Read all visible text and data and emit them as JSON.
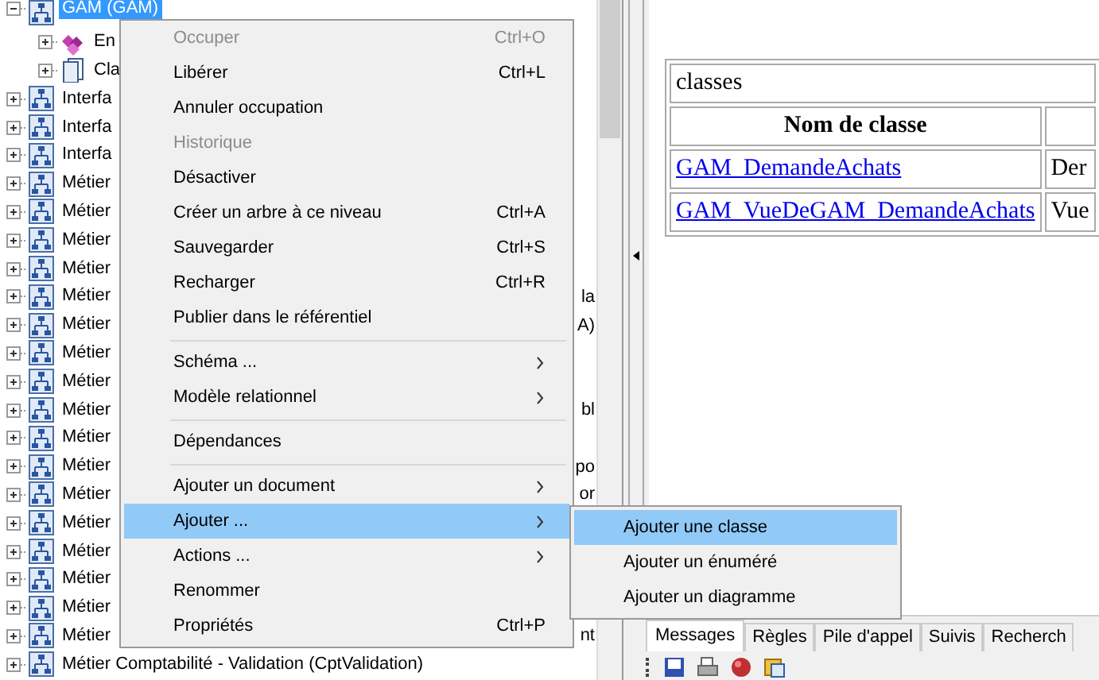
{
  "tree": [
    {
      "label": "GAM (GAM)",
      "selected": true,
      "expanded": true,
      "children": [
        {
          "label": "En",
          "selected": false,
          "expanded": false
        },
        {
          "label": "Cla",
          "selected": false,
          "expanded": false
        }
      ]
    },
    {
      "label": "Interfa",
      "selected": false,
      "expanded": false
    },
    {
      "label": "Interfa",
      "selected": false,
      "expanded": false
    },
    {
      "label": "Interfa",
      "selected": false,
      "expanded": false
    },
    {
      "label": "Métier",
      "selected": false,
      "expanded": false
    },
    {
      "label": "Métier",
      "selected": false,
      "expanded": false
    },
    {
      "label": "Métier",
      "selected": false,
      "expanded": false
    },
    {
      "label": "Métier",
      "selected": false,
      "expanded": false
    },
    {
      "label": "Métier",
      "tail": "la",
      "selected": false,
      "expanded": false
    },
    {
      "label": "Métier",
      "tail": "A)",
      "selected": false,
      "expanded": false
    },
    {
      "label": "Métier",
      "selected": false,
      "expanded": false
    },
    {
      "label": "Métier",
      "selected": false,
      "expanded": false
    },
    {
      "label": "Métier",
      "tail": "bl",
      "selected": false,
      "expanded": false
    },
    {
      "label": "Métier",
      "selected": false,
      "expanded": false
    },
    {
      "label": "Métier",
      "tail": "po",
      "selected": false,
      "expanded": false
    },
    {
      "label": "Métier",
      "tail": "or",
      "selected": false,
      "expanded": false
    },
    {
      "label": "Métier",
      "selected": false,
      "expanded": false
    },
    {
      "label": "Métier",
      "selected": false,
      "expanded": false
    },
    {
      "label": "Métier",
      "selected": false,
      "expanded": false
    },
    {
      "label": "Métier",
      "selected": false,
      "expanded": false
    },
    {
      "label": "Métier",
      "tail": "nt",
      "selected": false,
      "expanded": false
    },
    {
      "label": "Métier Comptabilité - Validation (CptValidation)",
      "selected": false,
      "expanded": false
    }
  ],
  "document": {
    "caption": "classes",
    "columns": [
      "Nom de classe"
    ],
    "rows": [
      {
        "link": "GAM_DemandeAchats",
        "column_2": "Der"
      },
      {
        "link": "GAM_VueDeGAM_DemandeAchats",
        "column_2": "Vue"
      }
    ]
  },
  "bottom_tabs": [
    {
      "label": "Messages",
      "selected": true
    },
    {
      "label": "Règles",
      "selected": false
    },
    {
      "label": "Pile d'appel",
      "selected": false
    },
    {
      "label": "Suivis",
      "selected": false
    },
    {
      "label": "Recherch",
      "selected": false
    }
  ],
  "context_menu": [
    {
      "kind": "item",
      "label": "Occuper",
      "shortcut": "Ctrl+O",
      "disabled": true,
      "submenu": false,
      "selected": false
    },
    {
      "kind": "item",
      "label": "Libérer",
      "shortcut": "Ctrl+L",
      "disabled": false,
      "submenu": false,
      "selected": false
    },
    {
      "kind": "item",
      "label": "Annuler occupation",
      "disabled": false,
      "submenu": false,
      "selected": false
    },
    {
      "kind": "item",
      "label": "Historique",
      "disabled": true,
      "submenu": false,
      "selected": false
    },
    {
      "kind": "item",
      "label": "Désactiver",
      "disabled": false,
      "submenu": false,
      "selected": false
    },
    {
      "kind": "item",
      "label": "Créer un arbre à ce niveau",
      "shortcut": "Ctrl+A",
      "disabled": false,
      "submenu": false,
      "selected": false
    },
    {
      "kind": "item",
      "label": "Sauvegarder",
      "shortcut": "Ctrl+S",
      "disabled": false,
      "submenu": false,
      "selected": false
    },
    {
      "kind": "item",
      "label": "Recharger",
      "shortcut": "Ctrl+R",
      "disabled": false,
      "submenu": false,
      "selected": false
    },
    {
      "kind": "item",
      "label": "Publier dans le référentiel",
      "disabled": false,
      "submenu": false,
      "selected": false
    },
    {
      "kind": "separator"
    },
    {
      "kind": "item",
      "label": "Schéma ...",
      "disabled": false,
      "submenu": true,
      "selected": false
    },
    {
      "kind": "item",
      "label": "Modèle relationnel",
      "disabled": false,
      "submenu": true,
      "selected": false
    },
    {
      "kind": "separator"
    },
    {
      "kind": "item",
      "label": "Dépendances",
      "disabled": false,
      "submenu": false,
      "selected": false
    },
    {
      "kind": "separator"
    },
    {
      "kind": "item",
      "label": "Ajouter un document",
      "disabled": false,
      "submenu": true,
      "selected": false
    },
    {
      "kind": "item",
      "label": "Ajouter ...",
      "disabled": false,
      "submenu": true,
      "selected": true
    },
    {
      "kind": "item",
      "label": "Actions ...",
      "disabled": false,
      "submenu": true,
      "selected": false
    },
    {
      "kind": "item",
      "label": "Renommer",
      "disabled": false,
      "submenu": false,
      "selected": false
    },
    {
      "kind": "item",
      "label": "Propriétés",
      "shortcut": "Ctrl+P",
      "disabled": false,
      "submenu": false,
      "selected": false
    }
  ],
  "submenu": [
    {
      "label": "Ajouter une classe",
      "selected": true
    },
    {
      "label": "Ajouter un énuméré",
      "selected": false
    },
    {
      "label": "Ajouter un diagramme",
      "selected": false
    }
  ]
}
